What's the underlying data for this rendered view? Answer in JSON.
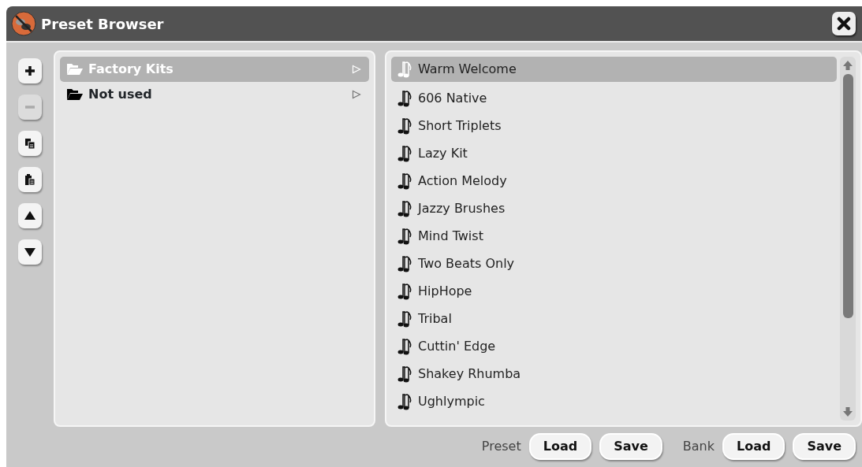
{
  "window": {
    "title": "Preset Browser"
  },
  "toolbar": [
    {
      "kind": "add",
      "disabled": false
    },
    {
      "kind": "remove",
      "disabled": true
    },
    {
      "kind": "copy",
      "disabled": false
    },
    {
      "kind": "paste",
      "disabled": false
    },
    {
      "kind": "up",
      "disabled": false
    },
    {
      "kind": "down",
      "disabled": false
    }
  ],
  "folders": [
    {
      "label": "Factory Kits",
      "selected": true
    },
    {
      "label": "Not used",
      "selected": false
    }
  ],
  "presets": [
    {
      "label": "Warm Welcome",
      "selected": true
    },
    {
      "label": "606 Native",
      "selected": false
    },
    {
      "label": "Short Triplets",
      "selected": false
    },
    {
      "label": "Lazy Kit",
      "selected": false
    },
    {
      "label": "Action Melody",
      "selected": false
    },
    {
      "label": "Jazzy Brushes",
      "selected": false
    },
    {
      "label": "Mind Twist",
      "selected": false
    },
    {
      "label": "Two Beats Only",
      "selected": false
    },
    {
      "label": "HipHope",
      "selected": false
    },
    {
      "label": "Tribal",
      "selected": false
    },
    {
      "label": "Cuttin' Edge",
      "selected": false
    },
    {
      "label": "Shakey Rhumba",
      "selected": false
    },
    {
      "label": "Ughlympic",
      "selected": false
    }
  ],
  "footer": [
    {
      "label": "Preset",
      "buttons": [
        "Load",
        "Save"
      ]
    },
    {
      "label": "Bank",
      "buttons": [
        "Load",
        "Save"
      ]
    }
  ]
}
